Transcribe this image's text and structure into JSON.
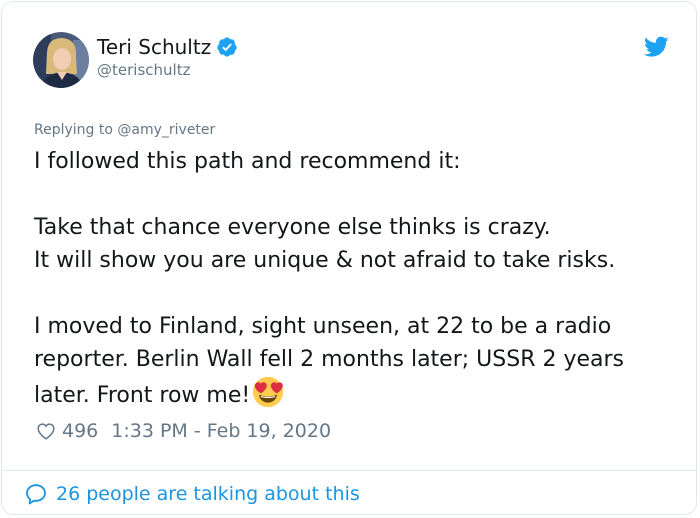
{
  "author": {
    "name": "Teri Schultz",
    "handle": "@terischultz",
    "verified": true,
    "avatar_icon": "avatar"
  },
  "platform_icon": "twitter-bird-icon",
  "replying": {
    "prefix": "Replying to",
    "mention": "@amy_riveter"
  },
  "tweet": {
    "line1": "I followed this path and recommend it:",
    "line2": "Take that chance everyone else thinks is crazy.",
    "line3": "It will show you are unique & not afraid to take risks.",
    "line4": "I moved to Finland, sight unseen, at 22 to be a radio reporter. Berlin Wall fell 2 months later; USSR 2 years later. Front row me!",
    "emoji": "heart-eyes-emoji"
  },
  "meta": {
    "likes": "496",
    "timestamp": "1:33 PM - Feb 19, 2020"
  },
  "footer": {
    "talking": "26 people are talking about this"
  },
  "colors": {
    "text": "#14171a",
    "secondary": "#657786",
    "accent": "#1b95e0",
    "border": "#e1e8ed"
  }
}
